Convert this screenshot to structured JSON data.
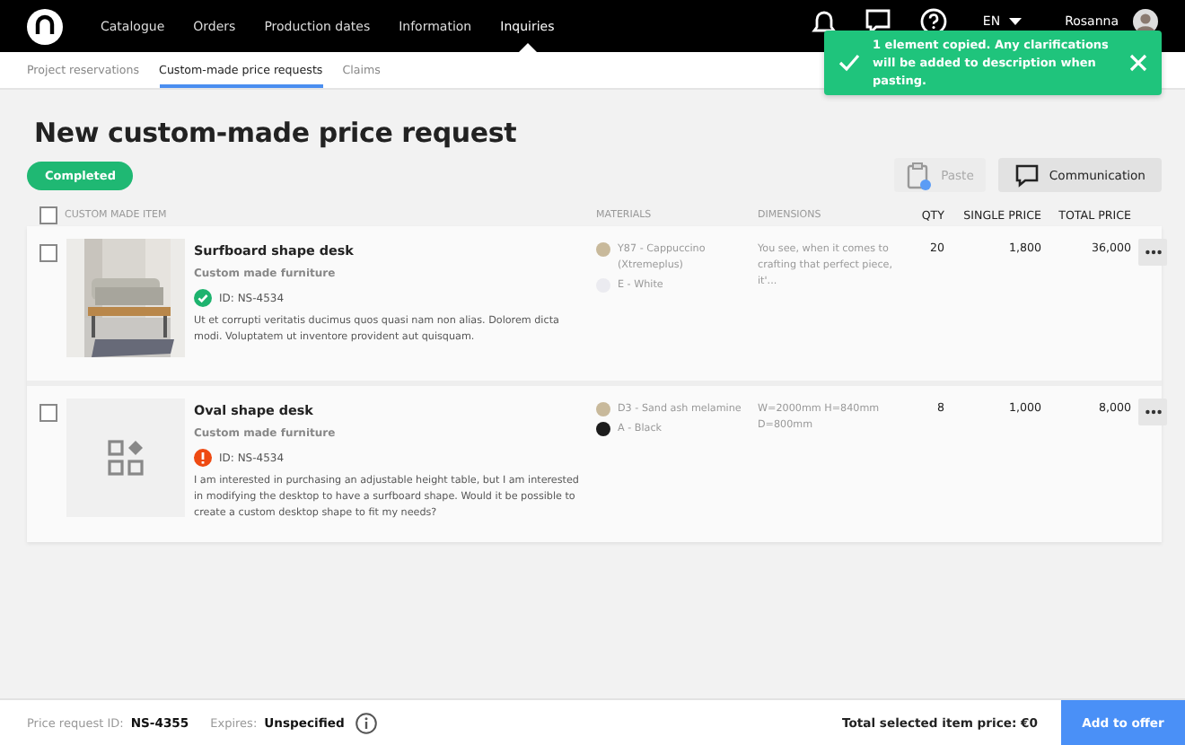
{
  "nav": {
    "items": [
      {
        "label": "Catalogue",
        "selected": false
      },
      {
        "label": "Orders",
        "selected": false
      },
      {
        "label": "Production dates",
        "selected": false
      },
      {
        "label": "Information",
        "selected": false
      },
      {
        "label": "Inquiries",
        "selected": true
      }
    ],
    "language": "EN",
    "user": "Rosanna"
  },
  "subtabs": [
    {
      "label": "Project reservations",
      "selected": false
    },
    {
      "label": "Custom-made price requests",
      "selected": true
    },
    {
      "label": "Claims",
      "selected": false
    }
  ],
  "toast": {
    "message": "1 element copied. Any clarifications will be added to description when pasting."
  },
  "title": "New custom-made price request",
  "status_badge": "Completed",
  "toolbar": {
    "paste": {
      "label": "Paste",
      "disabled": true
    },
    "communication": {
      "label": "Communication"
    }
  },
  "table": {
    "columns": [
      "CUSTOM MADE ITEM",
      "MATERIALS",
      "DIMENSIONS",
      "QTY",
      "SINGLE PRICE",
      "TOTAL PRICE"
    ],
    "header_checked": false,
    "rows": [
      {
        "checked": false,
        "name": "Surfboard shape desk",
        "category": "Custom made furniture",
        "approved": true,
        "id": "ID: NS-4534",
        "description": "Ut et corrupti veritatis ducimus quos quasi nam non alias. Dolorem dicta modi. Voluptatem ut inventore provident aut quisquam.",
        "materials": [
          {
            "label": "Y87 - Cappuccino (Xtremeplus)",
            "color": "#c8b99b"
          },
          {
            "label": "E - White",
            "color": "#ebebf0"
          }
        ],
        "dimensions": "You see, when it comes to crafting that perfect piece, it'...",
        "qty": "20",
        "single_price": "1,800",
        "total_price": "36,000"
      },
      {
        "checked": false,
        "kind": "placeholder",
        "name": "Oval shape desk",
        "category": "Custom made furniture",
        "approved": false,
        "id": "ID: NS-4534",
        "description": "I am interested in purchasing an adjustable height table, but I am interested in modifying the desktop to have a surfboard shape. Would it be possible to create a custom desktop shape to fit my needs?",
        "materials": [
          {
            "label": "D3 - Sand ash melamine",
            "color": "#c8b99b"
          },
          {
            "label": "A - Black",
            "color": "#1c1c1c"
          }
        ],
        "dimensions": "W=2000mm H=840mm D=800mm",
        "qty": "8",
        "single_price": "1,000",
        "total_price": "8,000"
      }
    ]
  },
  "footer": {
    "id_label": "Price request ID:",
    "id_value": "NS-4355",
    "expires_label": "Expires:",
    "expires_value": "Unspecified",
    "total": "Total selected item price: €0",
    "action": "Add to offer"
  }
}
